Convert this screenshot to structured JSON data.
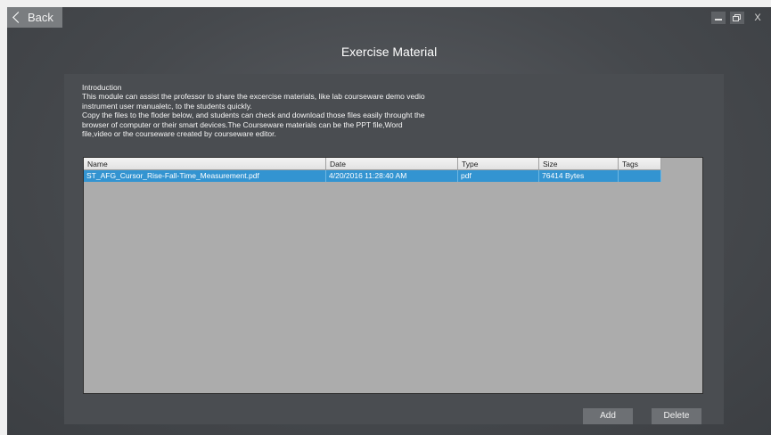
{
  "topbar": {
    "back_label": "Back",
    "close_glyph": "X"
  },
  "title": "Exercise Material",
  "intro": {
    "line1": "Introduction",
    "line2": "This module can assist the professor to share the excercise materials, like lab courseware demo vedio",
    "line3": "instrument user manualetc, to the students quickly.",
    "line4": "Copy the files to the floder below, and students can check and download those files easily throught the",
    "line5": "browser of computer or their smart devices.The Courseware materials can be the PPT file,Word",
    "line6": "file,video or the courseware created by courseware editor."
  },
  "table": {
    "columns": [
      "Name",
      "Date",
      "Type",
      "Size",
      "Tags"
    ],
    "rows": [
      {
        "name": "ST_AFG_Cursor_Rise-Fall-Time_Measurement.pdf",
        "date": "4/20/2016 11:28:40 AM",
        "type": "pdf",
        "size": "76414 Bytes",
        "tags": ""
      }
    ],
    "selected_row": 0,
    "selection_color": "#3394d1"
  },
  "actions": {
    "add_label": "Add",
    "delete_label": "Delete"
  },
  "icons": [
    "chevron-left-icon",
    "minimize-icon",
    "restore-icon",
    "close-icon"
  ]
}
